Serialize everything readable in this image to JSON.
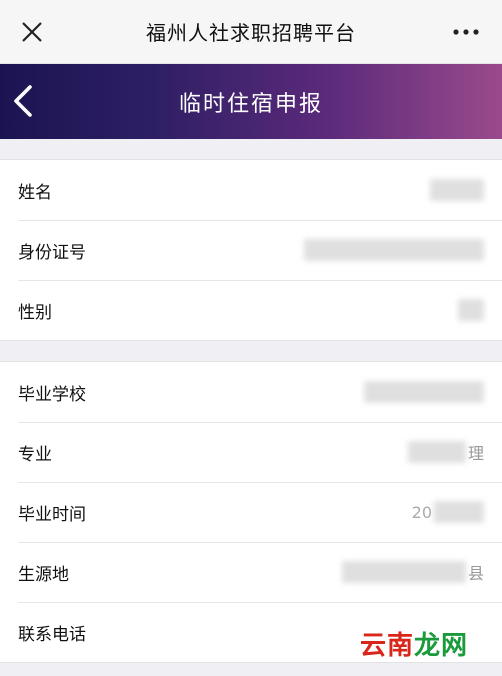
{
  "wechat_bar": {
    "title": "福州人社求职招聘平台",
    "close_icon": "close-icon",
    "more_icon": "more-icon"
  },
  "header": {
    "title": "临时住宿申报",
    "back_icon": "chevron-left-icon",
    "gradient_start": "#1b1452",
    "gradient_end": "#9a4a8c"
  },
  "groups": [
    {
      "rows": [
        {
          "label": "姓名",
          "value": ""
        },
        {
          "label": "身份证号",
          "value": ""
        },
        {
          "label": "性别",
          "value": ""
        }
      ]
    },
    {
      "rows": [
        {
          "label": "毕业学校",
          "value": ""
        },
        {
          "label": "专业",
          "value_tail": "理"
        },
        {
          "label": "毕业时间",
          "value_head": "20"
        },
        {
          "label": "生源地",
          "value_tail": "县"
        },
        {
          "label": "联系电话",
          "value": ""
        }
      ]
    }
  ],
  "watermark": {
    "chars": [
      "云",
      "南",
      "龙",
      "网"
    ],
    "colors": [
      "#d8261b",
      "#d8261b",
      "#1a9a3a",
      "#1a9a3a"
    ]
  }
}
